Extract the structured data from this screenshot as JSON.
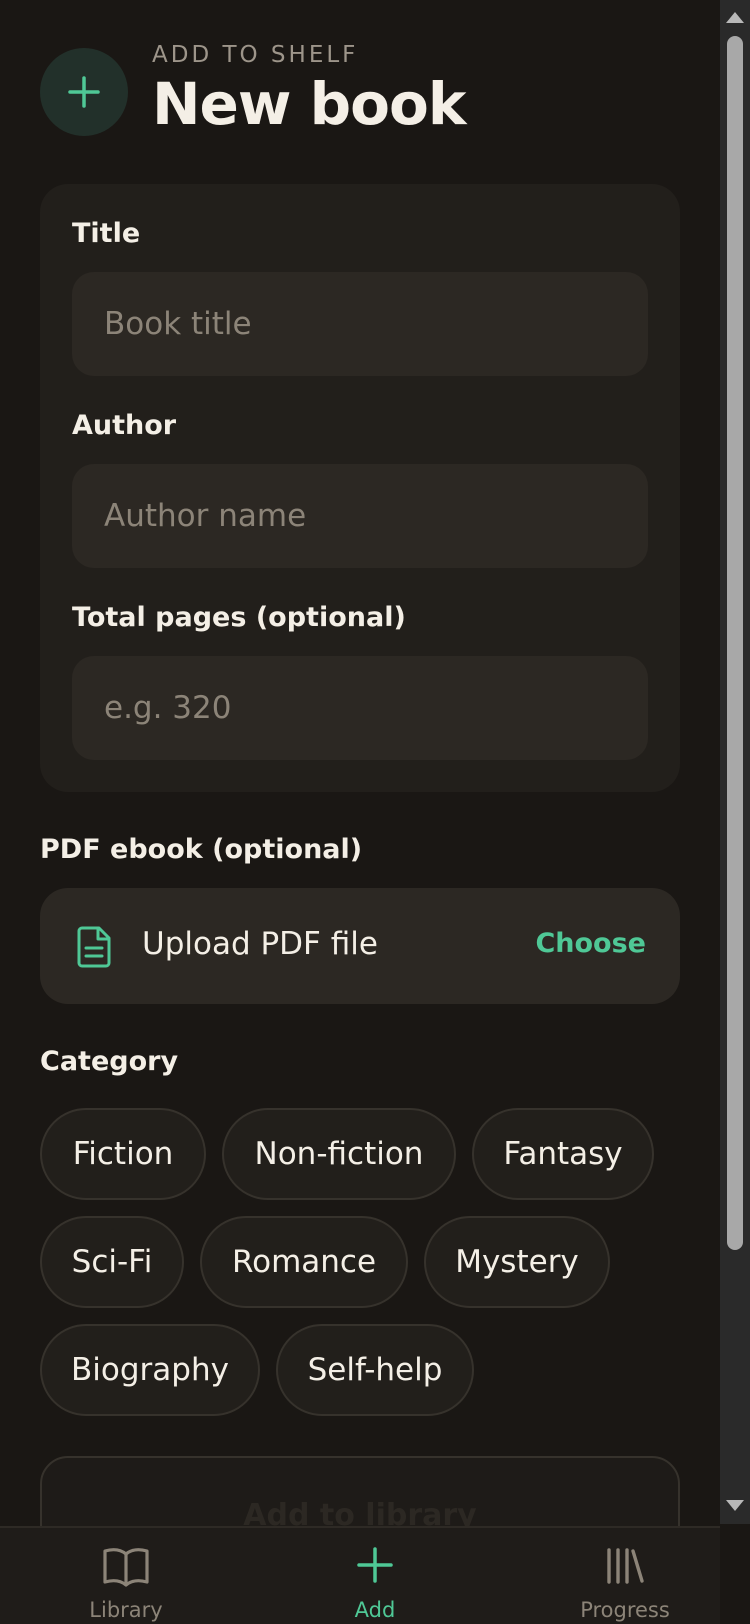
{
  "header": {
    "kicker": "ADD TO SHELF",
    "title": "New book",
    "icon": "plus-icon"
  },
  "form": {
    "title_label": "Title",
    "title_placeholder": "Book title",
    "title_value": "",
    "author_label": "Author",
    "author_placeholder": "Author name",
    "author_value": "",
    "pages_label": "Total pages (optional)",
    "pages_placeholder": "e.g. 320",
    "pages_value": ""
  },
  "pdf": {
    "label": "PDF ebook (optional)",
    "upload_text": "Upload PDF file",
    "choose_label": "Choose",
    "icon": "file-text-icon"
  },
  "category": {
    "label": "Category",
    "options": [
      "Fiction",
      "Non-fiction",
      "Fantasy",
      "Sci-Fi",
      "Romance",
      "Mystery",
      "Biography",
      "Self-help"
    ]
  },
  "submit": {
    "label": "Add to library"
  },
  "nav": {
    "items": [
      {
        "label": "Library",
        "icon": "book-open-icon",
        "active": false
      },
      {
        "label": "Add",
        "icon": "plus-icon",
        "active": true
      },
      {
        "label": "Progress",
        "icon": "bookshelf-icon",
        "active": false
      }
    ]
  },
  "colors": {
    "background": "#1a1714",
    "card": "#221f1b",
    "input": "#2c2823",
    "accent": "#4fc896",
    "text": "#f4efe6",
    "muted": "#8c8478"
  }
}
